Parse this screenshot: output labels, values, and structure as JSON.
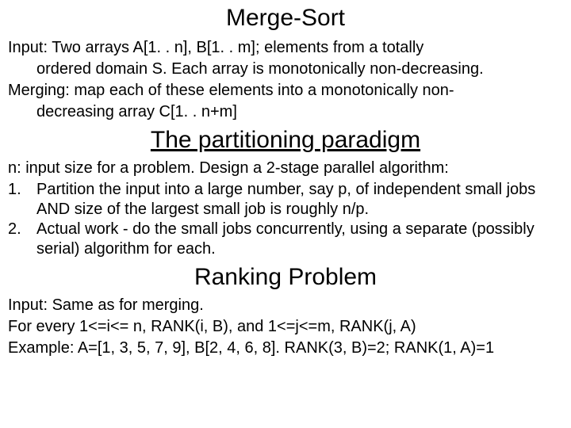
{
  "title": "Merge-Sort",
  "input_line1": "Input: Two arrays A[1. . n], B[1. . m]; elements from a totally",
  "input_line2": "ordered domain S. Each array is monotonically non-decreasing.",
  "merging_line1": "Merging: map each of these elements into a monotonically non-",
  "merging_line2": "decreasing array C[1. . n+m]",
  "subtitle1": "The partitioning paradigm",
  "paradigm_intro": "n: input size for a problem. Design a 2-stage parallel algorithm:",
  "step1_num": "1.",
  "step1_text": "Partition the input into a large number, say p, of independent small jobs AND size of the largest small job is roughly n/p.",
  "step2_num": "2.",
  "step2_text": "Actual work - do the small jobs concurrently, using a separate (possibly serial) algorithm for each.",
  "subtitle2": "Ranking Problem",
  "ranking_line1": "Input: Same as for merging.",
  "ranking_line2": "For every 1<=i<= n, RANK(i, B), and 1<=j<=m, RANK(j, A)",
  "ranking_line3": "Example: A=[1, 3, 5, 7, 9], B[2, 4, 6, 8]. RANK(3, B)=2; RANK(1, A)=1"
}
